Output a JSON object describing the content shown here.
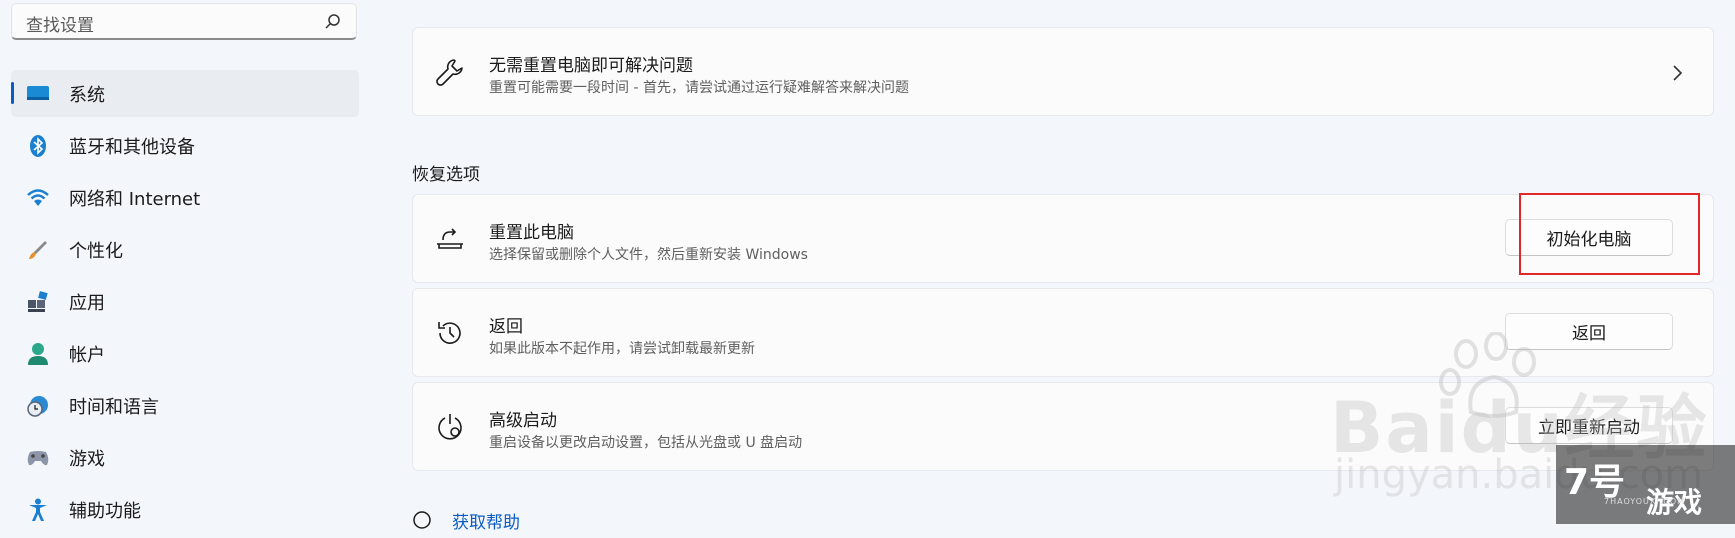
{
  "search": {
    "placeholder": "查找设置",
    "icon": "search-icon"
  },
  "sidebar": {
    "items": [
      {
        "label": "系统",
        "icon": "monitor-icon",
        "active": true
      },
      {
        "label": "蓝牙和其他设备",
        "icon": "bluetooth-icon",
        "active": false
      },
      {
        "label": "网络和 Internet",
        "icon": "wifi-icon",
        "active": false
      },
      {
        "label": "个性化",
        "icon": "brush-icon",
        "active": false
      },
      {
        "label": "应用",
        "icon": "apps-icon",
        "active": false
      },
      {
        "label": "帐户",
        "icon": "person-icon",
        "active": false
      },
      {
        "label": "时间和语言",
        "icon": "clock-globe-icon",
        "active": false
      },
      {
        "label": "游戏",
        "icon": "gamepad-icon",
        "active": false
      },
      {
        "label": "辅助功能",
        "icon": "accessibility-icon",
        "active": false
      }
    ]
  },
  "main": {
    "troubleshoot": {
      "title": "无需重置电脑即可解决问题",
      "subtitle": "重置可能需要一段时间 - 首先，请尝试通过运行疑难解答来解决问题",
      "icon": "wrench-icon"
    },
    "section_label": "恢复选项",
    "recovery": [
      {
        "title": "重置此电脑",
        "subtitle": "选择保留或删除个人文件，然后重新安装 Windows",
        "button": "初始化电脑",
        "icon": "reset-pc-icon"
      },
      {
        "title": "返回",
        "subtitle": "如果此版本不起作用，请尝试卸载最新更新",
        "button": "返回",
        "icon": "history-icon"
      },
      {
        "title": "高级启动",
        "subtitle": "重启设备以更改启动设置，包括从光盘或 U 盘启动",
        "button": "立即重新启动",
        "icon": "advanced-startup-icon"
      }
    ],
    "help_link": "获取帮助"
  },
  "watermark": {
    "brand": "Baidu经验",
    "url": "jingyan.baidu.com"
  },
  "logo": {
    "text1": "7号",
    "text2": "游戏",
    "small": "7HAOYOUXI.COM"
  },
  "colors": {
    "accent": "#0a5cc4",
    "highlight": "#e02828"
  }
}
